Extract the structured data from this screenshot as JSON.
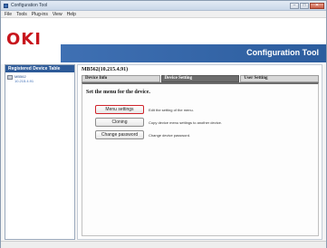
{
  "window": {
    "title": "Configuration Tool",
    "controls": {
      "minimize": "–",
      "maximize": "□",
      "close": "✕"
    }
  },
  "menu": [
    "File",
    "Tools",
    "Plug-ins",
    "View",
    "Help"
  ],
  "header": {
    "logo": "OKI",
    "banner_title": "Configuration Tool",
    "colors": {
      "logo": "#c8161d",
      "banner": "#2c5d9e"
    }
  },
  "sidebar": {
    "heading": "Registered Device Table",
    "items": [
      {
        "name": "MB562",
        "address": "10.215.4.91",
        "icon": "printer-icon"
      }
    ]
  },
  "main": {
    "device_title": "MB562(10.215.4.91)",
    "tabs": [
      {
        "label": "Device Info",
        "active": false
      },
      {
        "label": "Device Setting",
        "active": true
      },
      {
        "label": "User Setting",
        "active": false
      }
    ],
    "section_title": "Set the menu for the device.",
    "actions": [
      {
        "button": "Menu settings",
        "description": "Edit the setting of the menu.",
        "highlighted": true
      },
      {
        "button": "Cloning",
        "description": "Copy device menu settings to another device.",
        "highlighted": false
      },
      {
        "button": "Change password",
        "description": "Change device password.",
        "highlighted": false
      }
    ]
  }
}
